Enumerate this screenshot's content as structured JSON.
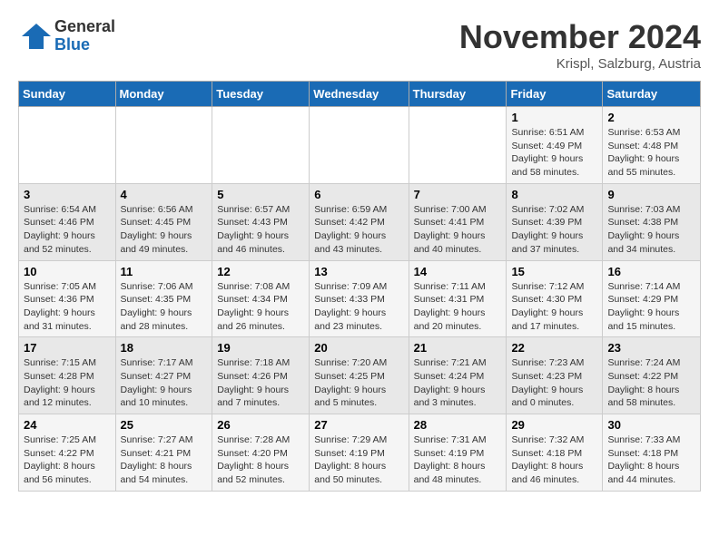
{
  "logo": {
    "general": "General",
    "blue": "Blue"
  },
  "title": "November 2024",
  "subtitle": "Krispl, Salzburg, Austria",
  "days_of_week": [
    "Sunday",
    "Monday",
    "Tuesday",
    "Wednesday",
    "Thursday",
    "Friday",
    "Saturday"
  ],
  "weeks": [
    [
      {
        "day": "",
        "detail": ""
      },
      {
        "day": "",
        "detail": ""
      },
      {
        "day": "",
        "detail": ""
      },
      {
        "day": "",
        "detail": ""
      },
      {
        "day": "",
        "detail": ""
      },
      {
        "day": "1",
        "detail": "Sunrise: 6:51 AM\nSunset: 4:49 PM\nDaylight: 9 hours and 58 minutes."
      },
      {
        "day": "2",
        "detail": "Sunrise: 6:53 AM\nSunset: 4:48 PM\nDaylight: 9 hours and 55 minutes."
      }
    ],
    [
      {
        "day": "3",
        "detail": "Sunrise: 6:54 AM\nSunset: 4:46 PM\nDaylight: 9 hours and 52 minutes."
      },
      {
        "day": "4",
        "detail": "Sunrise: 6:56 AM\nSunset: 4:45 PM\nDaylight: 9 hours and 49 minutes."
      },
      {
        "day": "5",
        "detail": "Sunrise: 6:57 AM\nSunset: 4:43 PM\nDaylight: 9 hours and 46 minutes."
      },
      {
        "day": "6",
        "detail": "Sunrise: 6:59 AM\nSunset: 4:42 PM\nDaylight: 9 hours and 43 minutes."
      },
      {
        "day": "7",
        "detail": "Sunrise: 7:00 AM\nSunset: 4:41 PM\nDaylight: 9 hours and 40 minutes."
      },
      {
        "day": "8",
        "detail": "Sunrise: 7:02 AM\nSunset: 4:39 PM\nDaylight: 9 hours and 37 minutes."
      },
      {
        "day": "9",
        "detail": "Sunrise: 7:03 AM\nSunset: 4:38 PM\nDaylight: 9 hours and 34 minutes."
      }
    ],
    [
      {
        "day": "10",
        "detail": "Sunrise: 7:05 AM\nSunset: 4:36 PM\nDaylight: 9 hours and 31 minutes."
      },
      {
        "day": "11",
        "detail": "Sunrise: 7:06 AM\nSunset: 4:35 PM\nDaylight: 9 hours and 28 minutes."
      },
      {
        "day": "12",
        "detail": "Sunrise: 7:08 AM\nSunset: 4:34 PM\nDaylight: 9 hours and 26 minutes."
      },
      {
        "day": "13",
        "detail": "Sunrise: 7:09 AM\nSunset: 4:33 PM\nDaylight: 9 hours and 23 minutes."
      },
      {
        "day": "14",
        "detail": "Sunrise: 7:11 AM\nSunset: 4:31 PM\nDaylight: 9 hours and 20 minutes."
      },
      {
        "day": "15",
        "detail": "Sunrise: 7:12 AM\nSunset: 4:30 PM\nDaylight: 9 hours and 17 minutes."
      },
      {
        "day": "16",
        "detail": "Sunrise: 7:14 AM\nSunset: 4:29 PM\nDaylight: 9 hours and 15 minutes."
      }
    ],
    [
      {
        "day": "17",
        "detail": "Sunrise: 7:15 AM\nSunset: 4:28 PM\nDaylight: 9 hours and 12 minutes."
      },
      {
        "day": "18",
        "detail": "Sunrise: 7:17 AM\nSunset: 4:27 PM\nDaylight: 9 hours and 10 minutes."
      },
      {
        "day": "19",
        "detail": "Sunrise: 7:18 AM\nSunset: 4:26 PM\nDaylight: 9 hours and 7 minutes."
      },
      {
        "day": "20",
        "detail": "Sunrise: 7:20 AM\nSunset: 4:25 PM\nDaylight: 9 hours and 5 minutes."
      },
      {
        "day": "21",
        "detail": "Sunrise: 7:21 AM\nSunset: 4:24 PM\nDaylight: 9 hours and 3 minutes."
      },
      {
        "day": "22",
        "detail": "Sunrise: 7:23 AM\nSunset: 4:23 PM\nDaylight: 9 hours and 0 minutes."
      },
      {
        "day": "23",
        "detail": "Sunrise: 7:24 AM\nSunset: 4:22 PM\nDaylight: 8 hours and 58 minutes."
      }
    ],
    [
      {
        "day": "24",
        "detail": "Sunrise: 7:25 AM\nSunset: 4:22 PM\nDaylight: 8 hours and 56 minutes."
      },
      {
        "day": "25",
        "detail": "Sunrise: 7:27 AM\nSunset: 4:21 PM\nDaylight: 8 hours and 54 minutes."
      },
      {
        "day": "26",
        "detail": "Sunrise: 7:28 AM\nSunset: 4:20 PM\nDaylight: 8 hours and 52 minutes."
      },
      {
        "day": "27",
        "detail": "Sunrise: 7:29 AM\nSunset: 4:19 PM\nDaylight: 8 hours and 50 minutes."
      },
      {
        "day": "28",
        "detail": "Sunrise: 7:31 AM\nSunset: 4:19 PM\nDaylight: 8 hours and 48 minutes."
      },
      {
        "day": "29",
        "detail": "Sunrise: 7:32 AM\nSunset: 4:18 PM\nDaylight: 8 hours and 46 minutes."
      },
      {
        "day": "30",
        "detail": "Sunrise: 7:33 AM\nSunset: 4:18 PM\nDaylight: 8 hours and 44 minutes."
      }
    ]
  ]
}
